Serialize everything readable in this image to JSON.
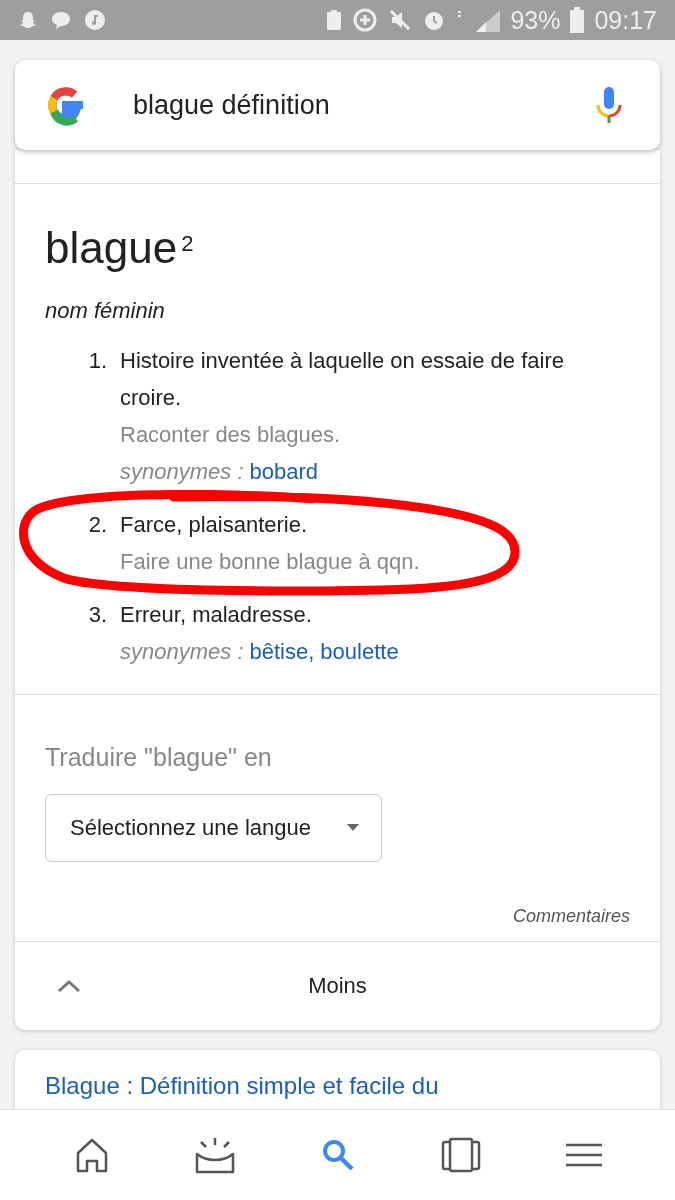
{
  "status_bar": {
    "battery": "93%",
    "time": "09:17"
  },
  "search": {
    "query": "blague définition"
  },
  "entry": {
    "headword": "blague$^{2}$",
    "part_of_speech": "nom féminin",
    "senses": [
      {
        "number": "1.",
        "definition": "Histoire inventée à laquelle on essaie de faire croire.",
        "example": "Raconter des blagues.",
        "synonyms_label": "synonymes :",
        "synonyms": [
          "bobard"
        ],
        "highlighted": false
      },
      {
        "number": "2.",
        "definition": "Farce, plaisanterie.",
        "example": "Faire une bonne blague à qqn.",
        "highlighted": true
      },
      {
        "number": "3.",
        "definition": "Erreur, maladresse.",
        "synonyms_label": "synonymes :",
        "synonyms": [
          "bêtise,",
          "boulette"
        ],
        "highlighted": false
      }
    ]
  },
  "translate": {
    "label": "Traduire \"blague\" en",
    "select": {
      "value": "Sélectionnez une langue"
    }
  },
  "feedback": "Commentaires",
  "collapse": {
    "label": "Moins"
  },
  "next_result": {
    "title": "Blague : Définition simple et facile du"
  },
  "nav": [
    {
      "kind": "home",
      "selected": false
    },
    {
      "kind": "updates",
      "selected": false
    },
    {
      "kind": "search",
      "selected": true
    },
    {
      "kind": "tabs",
      "selected": false
    },
    {
      "kind": "menu",
      "selected": false
    }
  ]
}
